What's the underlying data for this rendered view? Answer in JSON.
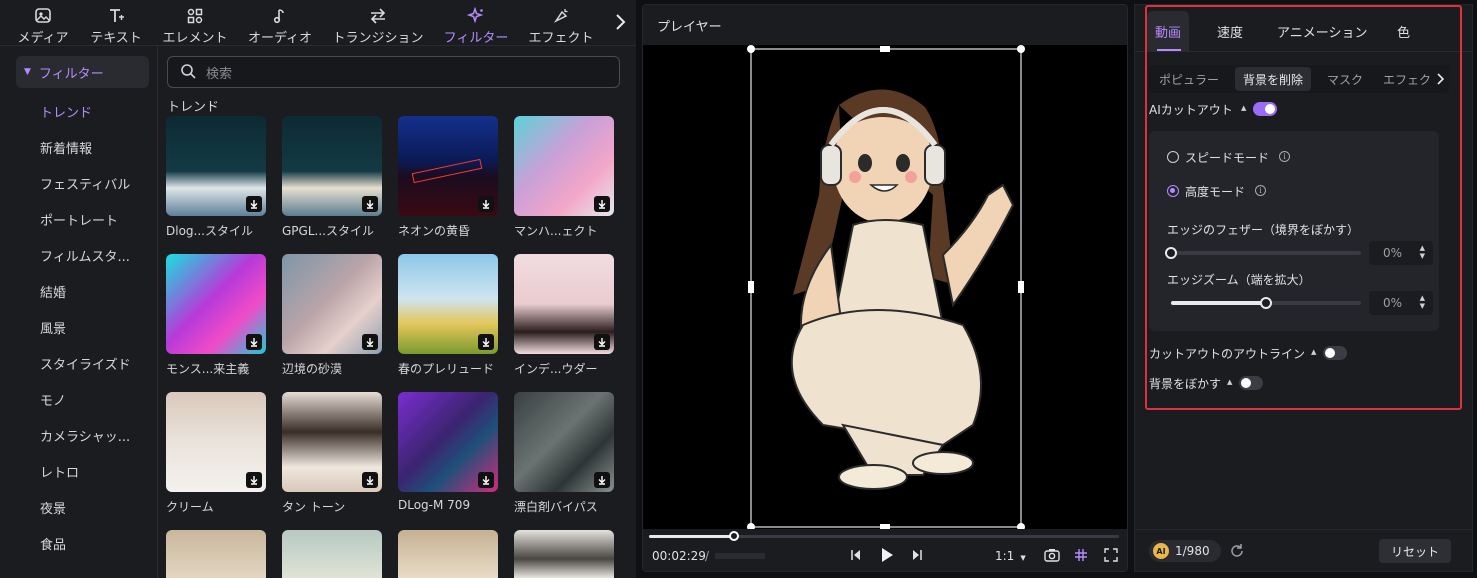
{
  "top_tabs": [
    {
      "label": "メディア",
      "icon": "media-icon"
    },
    {
      "label": "テキスト",
      "icon": "text-icon"
    },
    {
      "label": "エレメント",
      "icon": "element-icon"
    },
    {
      "label": "オーディオ",
      "icon": "audio-icon"
    },
    {
      "label": "トランジション",
      "icon": "transition-icon"
    },
    {
      "label": "フィルター",
      "icon": "filter-icon",
      "active": true
    },
    {
      "label": "エフェクト",
      "icon": "effect-icon"
    }
  ],
  "sidebar": {
    "header": "フィルター",
    "items": [
      "トレンド",
      "新着情報",
      "フェスティバル",
      "ポートレート",
      "フィルムスタ...",
      "結婚",
      "風景",
      "スタイライズド",
      "モノ",
      "カメラシャッ...",
      "レトロ",
      "夜景",
      "食品"
    ]
  },
  "search": {
    "placeholder": "検索"
  },
  "section_label": "トレンド",
  "filters": [
    {
      "label": "Dlog...スタイル"
    },
    {
      "label": "GPGL...スタイル"
    },
    {
      "label": "ネオンの黄昏"
    },
    {
      "label": "マンハ...ェクト"
    },
    {
      "label": "モンス...来主義"
    },
    {
      "label": "辺境の砂漠"
    },
    {
      "label": "春のプレリュード"
    },
    {
      "label": "インデ...ウダー"
    },
    {
      "label": "クリーム"
    },
    {
      "label": "タン トーン"
    },
    {
      "label": "DLog-M 709"
    },
    {
      "label": "漂白剤バイパス"
    }
  ],
  "player": {
    "title": "プレイヤー",
    "time": "00:02:29",
    "time_sep": "/",
    "ratio": "1:1"
  },
  "inspector": {
    "tabs": [
      "動画",
      "速度",
      "アニメーション",
      "色"
    ],
    "subtabs": [
      "ポピュラー",
      "背景を削除",
      "マスク",
      "エフェク"
    ],
    "ai_cutout": "AIカットアウト",
    "speed_mode": "スピードモード",
    "quality_mode": "高度モード",
    "edge_feather": "エッジのフェザー（境界をぼかす）",
    "edge_feather_value": "0%",
    "edge_zoom": "エッジズーム（端を拡大）",
    "edge_zoom_value": "0%",
    "outline": "カットアウトのアウトライン",
    "blur_bg": "背景をぼかす",
    "credits": "1/980",
    "reset": "リセット"
  },
  "values": {
    "edge_feather_level": 0.0,
    "edge_zoom_level": 0.5,
    "playhead_progress": 0.18
  }
}
